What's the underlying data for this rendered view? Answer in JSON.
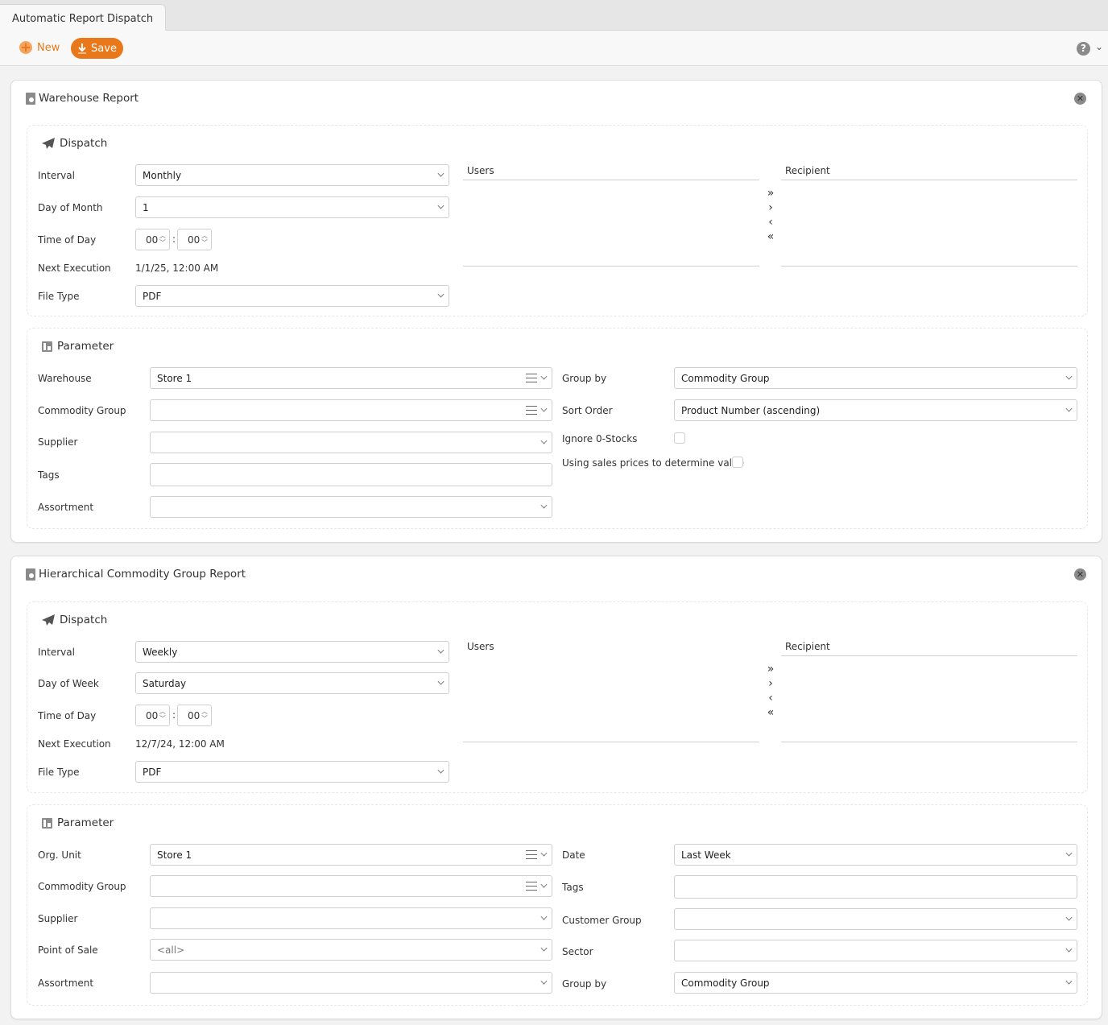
{
  "window": {
    "tab_title": "Automatic Report Dispatch"
  },
  "toolbar": {
    "new_label": "New",
    "save_label": "Save",
    "help_label": "?"
  },
  "colors": {
    "accent": "#e8781a",
    "icon_gray": "#8a8a8a"
  },
  "reports": [
    {
      "title": "Warehouse Report",
      "dispatch": {
        "title": "Dispatch",
        "interval_label": "Interval",
        "interval_value": "Monthly",
        "day_label": "Day of Month",
        "day_value": "1",
        "time_label": "Time of Day",
        "hour": "00",
        "minute": "00",
        "separator": ":",
        "next_label": "Next Execution",
        "next_value": "1/1/25, 12:00 AM",
        "filetype_label": "File Type",
        "filetype_value": "PDF",
        "users_label": "Users",
        "recipient_label": "Recipient",
        "transfer": {
          "all_right": "»",
          "right": "›",
          "left": "‹",
          "all_left": "«"
        }
      },
      "parameter": {
        "title": "Parameter",
        "warehouse_label": "Warehouse",
        "warehouse_value": "Store 1",
        "commodity_label": "Commodity Group",
        "commodity_value": "",
        "supplier_label": "Supplier",
        "supplier_value": "",
        "tags_label": "Tags",
        "tags_value": "",
        "assortment_label": "Assortment",
        "assortment_value": "",
        "groupby_label": "Group by",
        "groupby_value": "Commodity Group",
        "sort_label": "Sort Order",
        "sort_value": "Product Number (ascending)",
        "ignore_label": "Ignore 0-Stocks",
        "ignore_checked": false,
        "sales_label": "Using sales prices to determine value",
        "sales_checked": false
      }
    },
    {
      "title": "Hierarchical Commodity Group Report",
      "dispatch": {
        "title": "Dispatch",
        "interval_label": "Interval",
        "interval_value": "Weekly",
        "day_label": "Day of Week",
        "day_value": "Saturday",
        "time_label": "Time of Day",
        "hour": "00",
        "minute": "00",
        "separator": ":",
        "next_label": "Next Execution",
        "next_value": "12/7/24, 12:00 AM",
        "filetype_label": "File Type",
        "filetype_value": "PDF",
        "users_label": "Users",
        "recipient_label": "Recipient",
        "transfer": {
          "all_right": "»",
          "right": "›",
          "left": "‹",
          "all_left": "«"
        }
      },
      "parameter": {
        "title": "Parameter",
        "orgunit_label": "Org. Unit",
        "orgunit_value": "Store 1",
        "commodity_label": "Commodity Group",
        "commodity_value": "",
        "supplier_label": "Supplier",
        "supplier_value": "",
        "pos_label": "Point of Sale",
        "pos_value": "<all>",
        "assortment_label": "Assortment",
        "assortment_value": "",
        "date_label": "Date",
        "date_value": "Last Week",
        "tags_label": "Tags",
        "tags_value": "",
        "customer_label": "Customer Group",
        "customer_value": "",
        "sector_label": "Sector",
        "sector_value": "",
        "groupby_label": "Group by",
        "groupby_value": "Commodity Group"
      }
    }
  ]
}
